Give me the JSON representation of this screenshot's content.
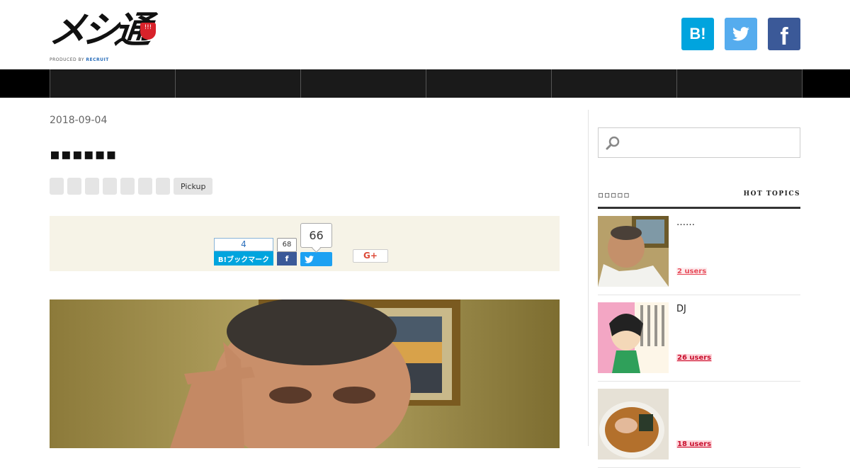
{
  "header": {
    "logo_text": "メシ通",
    "logo_badge": "!!!",
    "logo_sub_prefix": "PRODUCED BY",
    "logo_sub_brand": "RECRUIT",
    "share": {
      "hatena_label": "B!",
      "facebook_label": "f",
      "colors": {
        "hatena": "#00a4de",
        "twitter": "#55acee",
        "facebook": "#3b5998"
      }
    }
  },
  "nav": {
    "items": [
      "",
      "",
      "",
      "",
      "",
      ""
    ]
  },
  "article": {
    "date": "2018-09-04",
    "title": "▪▪▪▪▪▪",
    "tags": [
      "",
      "",
      "",
      "",
      "",
      "",
      "",
      "Pickup"
    ],
    "sharebar": {
      "hatena_count": "4",
      "hatena_label": "B!ブックマーク",
      "facebook_count": "68",
      "facebook_label": "f",
      "twitter_count": "66",
      "gplus_label": "G+"
    }
  },
  "sidebar": {
    "search": {
      "placeholder": "",
      "value": ""
    },
    "hot_topics": {
      "title": "▫▫▫▫▫",
      "subtitle": "HOT TOPICS",
      "items": [
        {
          "title": "……",
          "users": "2 users"
        },
        {
          "title": "DJ",
          "users": "26 users"
        },
        {
          "title": "",
          "users": "18 users"
        }
      ]
    }
  }
}
